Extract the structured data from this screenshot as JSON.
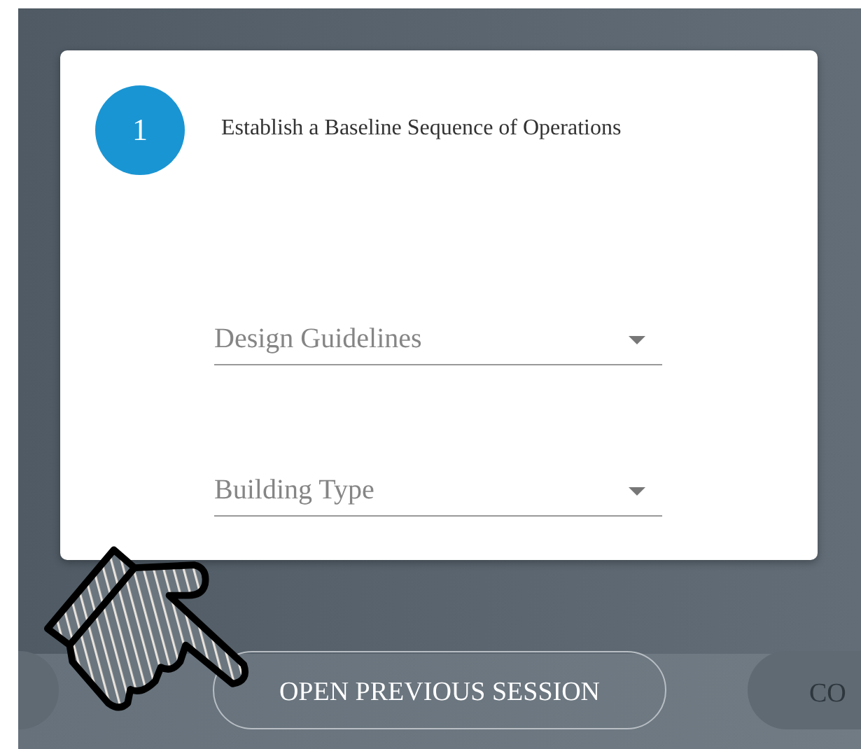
{
  "step": {
    "number": "1",
    "title": "Establish a Baseline Sequence of Operations"
  },
  "fields": [
    {
      "placeholder": "Design Guidelines"
    },
    {
      "placeholder": "Building Type"
    }
  ],
  "footer_buttons": [
    {
      "kind": "filled"
    },
    {
      "kind": "outlined",
      "label": "OPEN PREVIOUS SESSION"
    },
    {
      "kind": "filled",
      "label": "CO"
    }
  ]
}
